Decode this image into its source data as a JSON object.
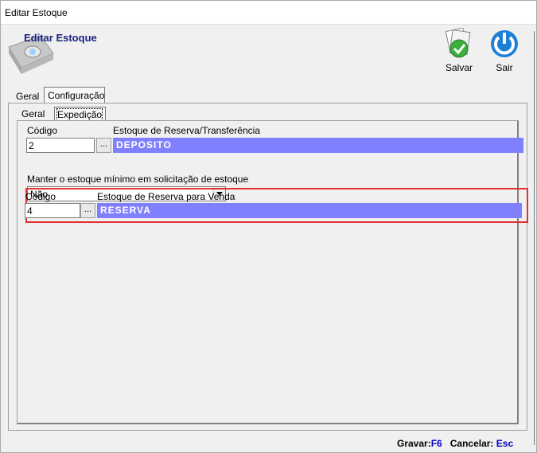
{
  "window": {
    "title": "Editar Estoque"
  },
  "header": {
    "title": "Editar Estoque"
  },
  "toolbar": {
    "save_label": "Salvar",
    "exit_label": "Sair"
  },
  "tabs": {
    "outer": [
      {
        "label": "Geral"
      },
      {
        "label": "Configuração"
      }
    ],
    "inner": [
      {
        "label": "Geral"
      },
      {
        "label": "Expedição"
      }
    ]
  },
  "form": {
    "transfer": {
      "code_label": "Código",
      "code_value": "2",
      "stock_label": "Estoque de Reserva/Transferência",
      "stock_value": "DEPOSITO"
    },
    "min_stock": {
      "label": "Manter o estoque mínimo em solicitação de estoque",
      "value": "Não"
    },
    "sale_reserve": {
      "code_label": "Código",
      "code_value": "4",
      "stock_label": "Estoque de Reserva para Venda",
      "stock_value": "RESERVA"
    },
    "ellipsis": "..."
  },
  "footer": {
    "save_label": "Gravar:",
    "save_key": "F6",
    "cancel_label": "Cancelar:",
    "cancel_key": "Esc"
  },
  "colors": {
    "lookup_bg": "#8080ff",
    "highlight": "#e03030",
    "header_title": "#1a237e"
  }
}
